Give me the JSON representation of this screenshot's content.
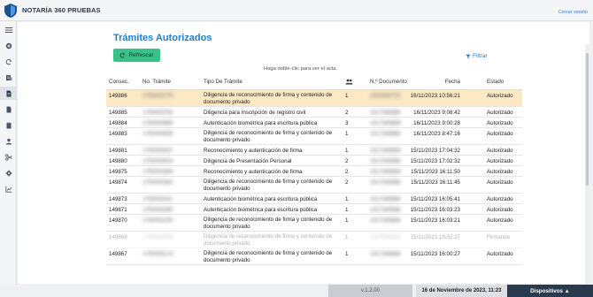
{
  "app": {
    "title": "NOTARÍA 360 PRUEBAS",
    "logout": "Cerrar sesión",
    "logo_icon": "shield-logo-icon"
  },
  "sidebar": {
    "items": [
      {
        "icon": "menu-icon",
        "active": false
      },
      {
        "icon": "plus-circle-icon",
        "active": false
      },
      {
        "icon": "refresh-icon",
        "active": false
      },
      {
        "icon": "document-list-icon",
        "active": false
      },
      {
        "icon": "document-icon",
        "active": true
      },
      {
        "icon": "file-icon",
        "active": false
      },
      {
        "icon": "clipboard-icon",
        "active": false
      },
      {
        "icon": "user-icon",
        "active": false
      },
      {
        "icon": "scissors-icon",
        "active": false
      },
      {
        "icon": "gear-icon",
        "active": false
      },
      {
        "icon": "chart-icon",
        "active": false
      }
    ]
  },
  "page": {
    "title": "Trámites Autorizados",
    "refresh_label": "Refrescar",
    "filter_label": "Filtrar",
    "hint": "Haga doble-clic para ver el acta."
  },
  "table": {
    "headers": {
      "consec": "Consec.",
      "num": "No. Trámite",
      "tipo": "Tipo De Trámite",
      "users_icon": "users-icon",
      "doc": "N.º Documento",
      "fecha": "Fecha",
      "estado": "Estado"
    },
    "rows": [
      {
        "consec": "149886",
        "num": "1750003775",
        "tipo": "Diligencia de reconocimiento de firma y contenido de documento privado",
        "n": "1",
        "doc": "1003453715",
        "fecha": "16/11/2023 10:56:21",
        "estado": "Autorizado",
        "selected": true,
        "faded": false
      },
      {
        "consec": "149885",
        "num": "1750003754",
        "tipo": "Diligencia para Inscripción de registro civil",
        "n": "2",
        "doc": "1017345888",
        "fecha": "16/11/2023 9:08:42",
        "estado": "Autorizado",
        "selected": false,
        "faded": false
      },
      {
        "consec": "149884",
        "num": "1750003689",
        "tipo": "Autenticación biométrica para escritura pública",
        "n": "3",
        "doc": "1017345888",
        "fecha": "16/11/2023 9:00:28",
        "estado": "Autorizado",
        "selected": false,
        "faded": false
      },
      {
        "consec": "149883",
        "num": "1750003635",
        "tipo": "Diligencia de reconocimiento de firma y contenido de documento privado",
        "n": "1",
        "doc": "1017345888",
        "fecha": "16/11/2023 8:47:16",
        "estado": "Autorizado",
        "selected": false,
        "faded": false
      },
      {
        "consec": "149881",
        "num": "1750003547",
        "tipo": "Reconocimiento y autenticación de firma",
        "n": "1",
        "doc": "1017345888",
        "fecha": "15/11/2023 17:04:32",
        "estado": "Autorizado",
        "selected": false,
        "faded": false
      },
      {
        "consec": "149880",
        "num": "1750003519",
        "tipo": "Diligencia de Presentación Personal",
        "n": "2",
        "doc": "1017345888",
        "fecha": "15/11/2023 17:02:32",
        "estado": "Autorizado",
        "selected": false,
        "faded": false
      },
      {
        "consec": "149875",
        "num": "1750003384",
        "tipo": "Reconocimiento y autenticación de firma",
        "n": "2",
        "doc": "1017345888",
        "fecha": "15/11/2023 16:11:50",
        "estado": "Autorizado",
        "selected": false,
        "faded": false
      },
      {
        "consec": "149874",
        "num": "1750003362",
        "tipo": "Diligencia de reconocimiento de firma y contenido de documento privado",
        "n": "2",
        "doc": "1017345888",
        "fecha": "15/11/2023 16:11:45",
        "estado": "Autorizado",
        "selected": false,
        "faded": false
      },
      {
        "consec": "149873",
        "num": "1750003311",
        "tipo": "Autenticación biométrica para escritura pública",
        "n": "1",
        "doc": "1017345888",
        "fecha": "15/11/2023 16:05:41",
        "estado": "Autorizado",
        "selected": false,
        "faded": false
      },
      {
        "consec": "149871",
        "num": "1750003265",
        "tipo": "Autenticación biométrica para escritura pública",
        "n": "1",
        "doc": "1017345888",
        "fecha": "15/11/2023 16:03:23",
        "estado": "Autorizado",
        "selected": false,
        "faded": false
      },
      {
        "consec": "149870",
        "num": "1750003230",
        "tipo": "Diligencia de reconocimiento de firma y contenido de documento privado",
        "n": "1",
        "doc": "1017345888",
        "fecha": "15/11/2023 16:03:21",
        "estado": "Autorizado",
        "selected": false,
        "faded": false
      },
      {
        "consec": "149868",
        "num": "1750003199",
        "tipo": "Diligencia de reconocimiento de firma y contenido de documento privado",
        "n": "1",
        "doc": "1017345888",
        "fecha": "15/11/2023 16:02:27",
        "estado": "Firmando",
        "selected": false,
        "faded": true
      },
      {
        "consec": "149867",
        "num": "1750003174",
        "tipo": "Diligencia de reconocimiento de firma y contenido de documento privado",
        "n": "1",
        "doc": "1017345888",
        "fecha": "15/11/2023 16:00:27",
        "estado": "Autorizado",
        "selected": false,
        "faded": false
      }
    ]
  },
  "footer": {
    "version": "v.1.2.00",
    "datetime": "16 de Noviembre de 2023, 11:23",
    "devices": "Dispositivos ▲"
  },
  "colors": {
    "accent": "#1c7fd0",
    "refresh_bg": "#38c28a",
    "selected_row": "#fde8c4",
    "devices_bg": "#2a3a4e"
  }
}
